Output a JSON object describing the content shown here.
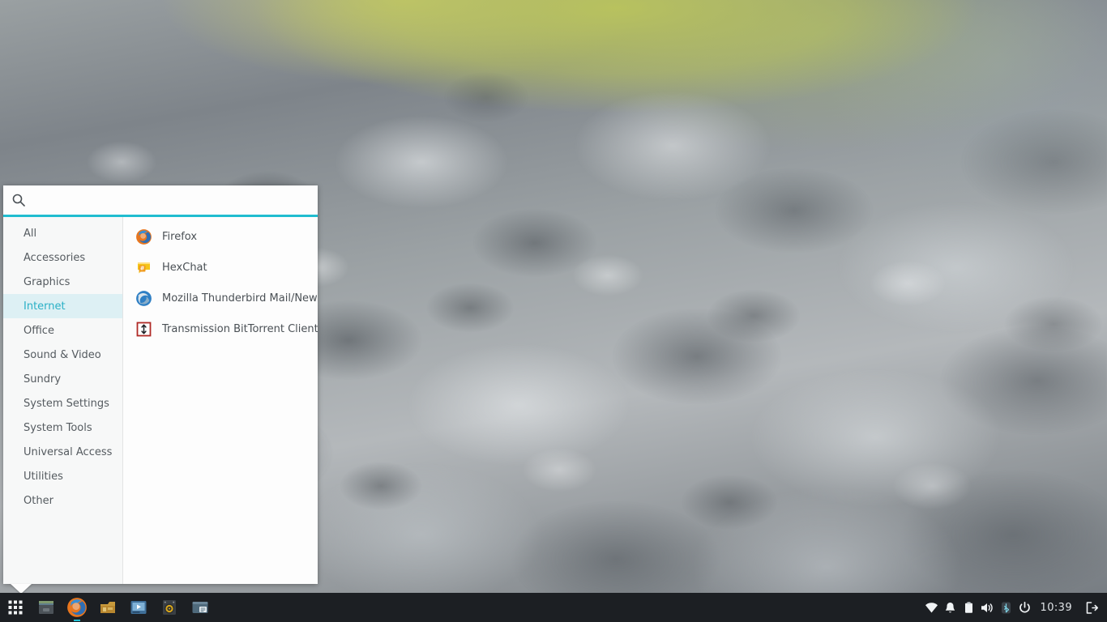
{
  "desktop": {
    "wallpaper_description": "blurred grey rock texture with green vegetation at top"
  },
  "app_menu": {
    "search": {
      "placeholder": "",
      "value": "",
      "icon": "search-icon"
    },
    "categories": [
      {
        "label": "All",
        "selected": false
      },
      {
        "label": "Accessories",
        "selected": false
      },
      {
        "label": "Graphics",
        "selected": false
      },
      {
        "label": "Internet",
        "selected": true
      },
      {
        "label": "Office",
        "selected": false
      },
      {
        "label": "Sound & Video",
        "selected": false
      },
      {
        "label": "Sundry",
        "selected": false
      },
      {
        "label": "System Settings",
        "selected": false
      },
      {
        "label": "System Tools",
        "selected": false
      },
      {
        "label": "Universal Access",
        "selected": false
      },
      {
        "label": "Utilities",
        "selected": false
      },
      {
        "label": "Other",
        "selected": false
      }
    ],
    "applications": [
      {
        "label": "Firefox",
        "icon": "firefox-icon"
      },
      {
        "label": "HexChat",
        "icon": "hexchat-icon"
      },
      {
        "label": "Mozilla Thunderbird Mail/News",
        "icon": "thunderbird-icon"
      },
      {
        "label": "Transmission BitTorrent Client",
        "icon": "transmission-icon"
      }
    ],
    "colors": {
      "accent": "#20bdd0",
      "selected_background": "#ddf0f4",
      "selected_text": "#2ab0c6",
      "sidebar_background": "#f7f8f8",
      "panel_background": "#fdfdfd"
    }
  },
  "panel": {
    "launchers": [
      {
        "name": "show-applications",
        "icon": "grid-icon",
        "running": false
      },
      {
        "name": "file-manager",
        "icon": "file-manager-icon",
        "running": false
      },
      {
        "name": "firefox",
        "icon": "firefox-icon",
        "running": true
      },
      {
        "name": "archive-manager",
        "icon": "archive-manager-icon",
        "running": false
      },
      {
        "name": "media-player",
        "icon": "media-player-icon",
        "running": false
      },
      {
        "name": "audio-player",
        "icon": "audio-player-icon",
        "running": false
      },
      {
        "name": "terminal",
        "icon": "terminal-icon",
        "running": false
      }
    ],
    "tray": [
      {
        "name": "network",
        "icon": "wifi-icon"
      },
      {
        "name": "notifications",
        "icon": "bell-icon"
      },
      {
        "name": "clipboard",
        "icon": "clipboard-icon"
      },
      {
        "name": "volume",
        "icon": "speaker-icon"
      },
      {
        "name": "bluetooth",
        "icon": "bluetooth-icon"
      },
      {
        "name": "power",
        "icon": "power-icon"
      }
    ],
    "clock": "10:39",
    "logout": {
      "name": "logout",
      "icon": "exit-icon"
    },
    "colors": {
      "background": "#1c1f23",
      "text": "#dfe3e6",
      "indicator": "#21c0d4"
    }
  }
}
